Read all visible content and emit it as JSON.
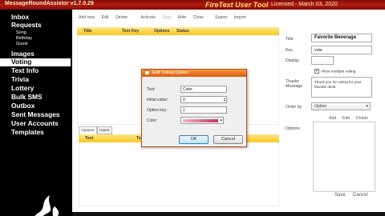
{
  "window": {
    "app_title": "MessageRoundAssistor v1.7.0.29",
    "product": "FireText User Tool",
    "license": "Licensed - March 03, 2020"
  },
  "sidebar": {
    "items": [
      {
        "label": "Inbox",
        "sub": false,
        "active": false
      },
      {
        "label": "Requests",
        "sub": false,
        "active": false
      },
      {
        "label": "Song",
        "sub": true,
        "active": false
      },
      {
        "label": "Birthday",
        "sub": true,
        "active": false
      },
      {
        "label": "Guest",
        "sub": true,
        "active": false
      },
      {
        "label": "Images",
        "sub": false,
        "active": false
      },
      {
        "label": "Voting",
        "sub": false,
        "active": true
      },
      {
        "label": "Text Info",
        "sub": false,
        "active": false
      },
      {
        "label": "Trivia",
        "sub": false,
        "active": false
      },
      {
        "label": "Lottery",
        "sub": false,
        "active": false
      },
      {
        "label": "Bulk SMS",
        "sub": false,
        "active": false
      },
      {
        "label": "Outbox",
        "sub": false,
        "active": false
      },
      {
        "label": "Sent Messages",
        "sub": false,
        "active": false
      },
      {
        "label": "User Accounts",
        "sub": false,
        "active": false
      },
      {
        "label": "Templates",
        "sub": false,
        "active": false
      }
    ],
    "logo_icon": "flame-logo-icon"
  },
  "toolbar": {
    "add_new": "Add new",
    "edit": "Edit",
    "delete": "Delete",
    "activate": "Activate",
    "stop": "Stop",
    "hide": "Hide",
    "close": "Close",
    "export": "Export",
    "import": "Import"
  },
  "grid": {
    "columns": [
      "Title",
      "Text Key",
      "Options",
      "Status"
    ]
  },
  "tabs": {
    "options": "Options",
    "users": "Users"
  },
  "options_grid": {
    "columns": [
      "Text",
      "Text Key"
    ]
  },
  "form": {
    "title_label": "Title",
    "title_value": "Favorite Beverage",
    "key_label": "Key",
    "key_value": "vote",
    "display_label": "Display",
    "display_value": "",
    "allow_multiple": "Allow multiple voting",
    "thanks_label_1": "Thanks",
    "thanks_label_2": "Message",
    "thanks_value": "Thank you for voting for your favorite drink.",
    "order_by_label": "Order by",
    "order_by_value": "Option",
    "options_label": "Options",
    "add": "Add",
    "edit": "Edit",
    "delete": "Delete",
    "save": "Save",
    "cancel": "Cancel"
  },
  "dialog": {
    "title": "Edit Voting Option",
    "text_label": "Text:",
    "text_value": "Coke",
    "initial_value_label": "Initial value:",
    "initial_value": "0",
    "option_key_label": "Option key:",
    "option_key_value": "1",
    "color_label": "Color:",
    "ok": "OK",
    "cancel": "Cancel",
    "colors": {
      "swatch_start": "#f3b2c4",
      "swatch_end": "#c23452"
    }
  }
}
